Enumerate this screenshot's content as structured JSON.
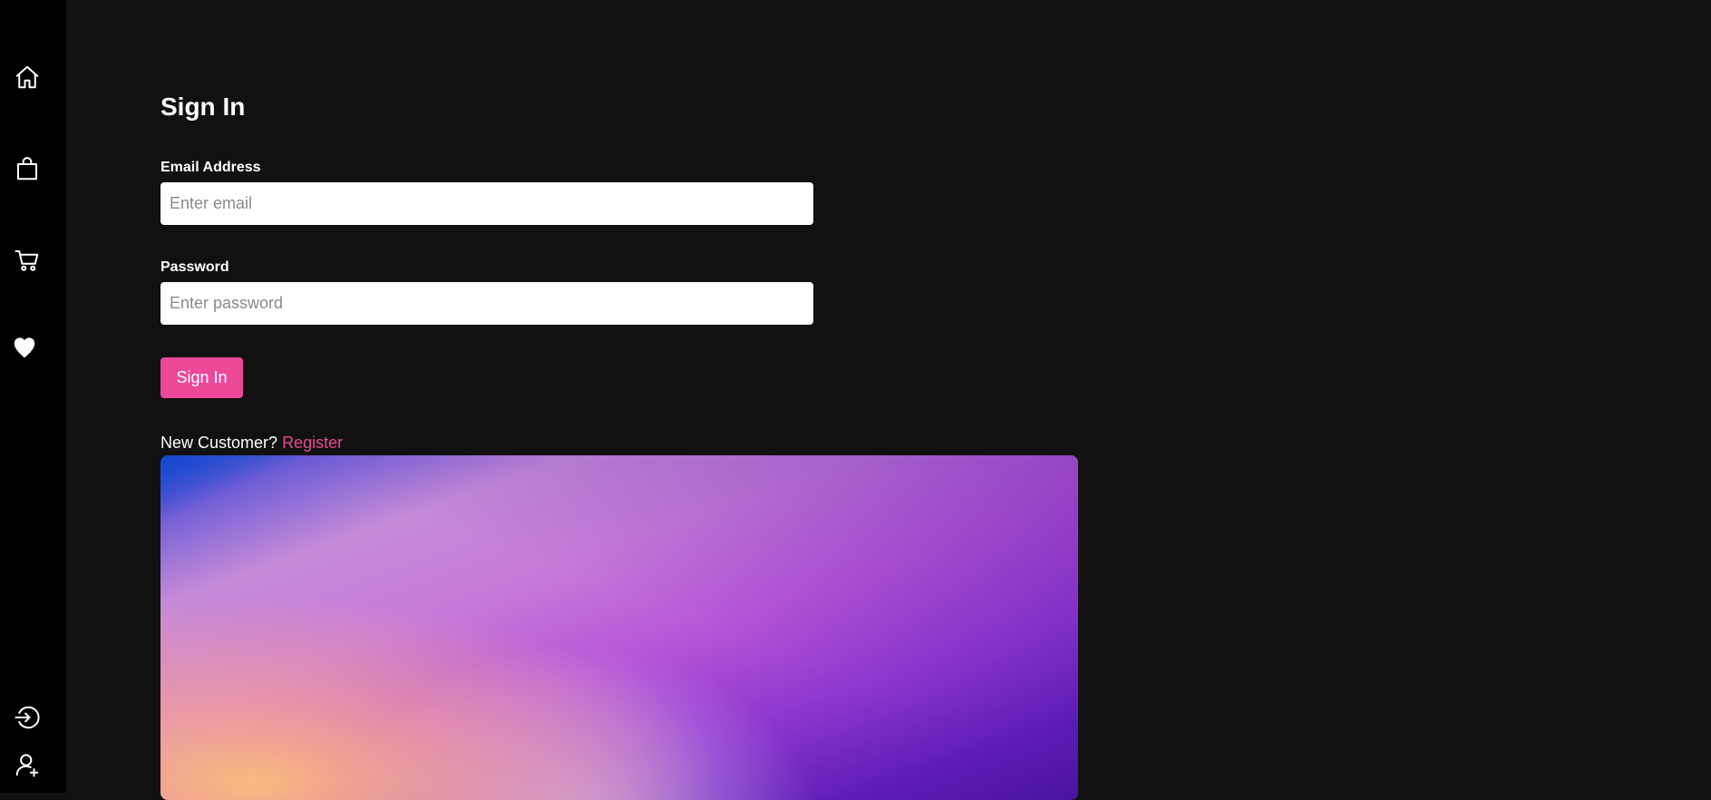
{
  "sidebar": {
    "top_items": [
      {
        "name": "home-icon"
      },
      {
        "name": "shopping-bag-icon"
      },
      {
        "name": "cart-icon"
      },
      {
        "name": "heart-icon"
      }
    ],
    "bottom_items": [
      {
        "name": "login-icon"
      },
      {
        "name": "user-plus-icon"
      }
    ]
  },
  "form": {
    "title": "Sign In",
    "email_label": "Email Address",
    "email_placeholder": "Enter email",
    "email_value": "",
    "password_label": "Password",
    "password_placeholder": "Enter password",
    "password_value": "",
    "submit_label": "Sign In",
    "new_customer_text": "New Customer?",
    "register_link": "Register"
  },
  "colors": {
    "accent": "#ec4899",
    "background": "#111111",
    "sidebar": "#000000"
  }
}
